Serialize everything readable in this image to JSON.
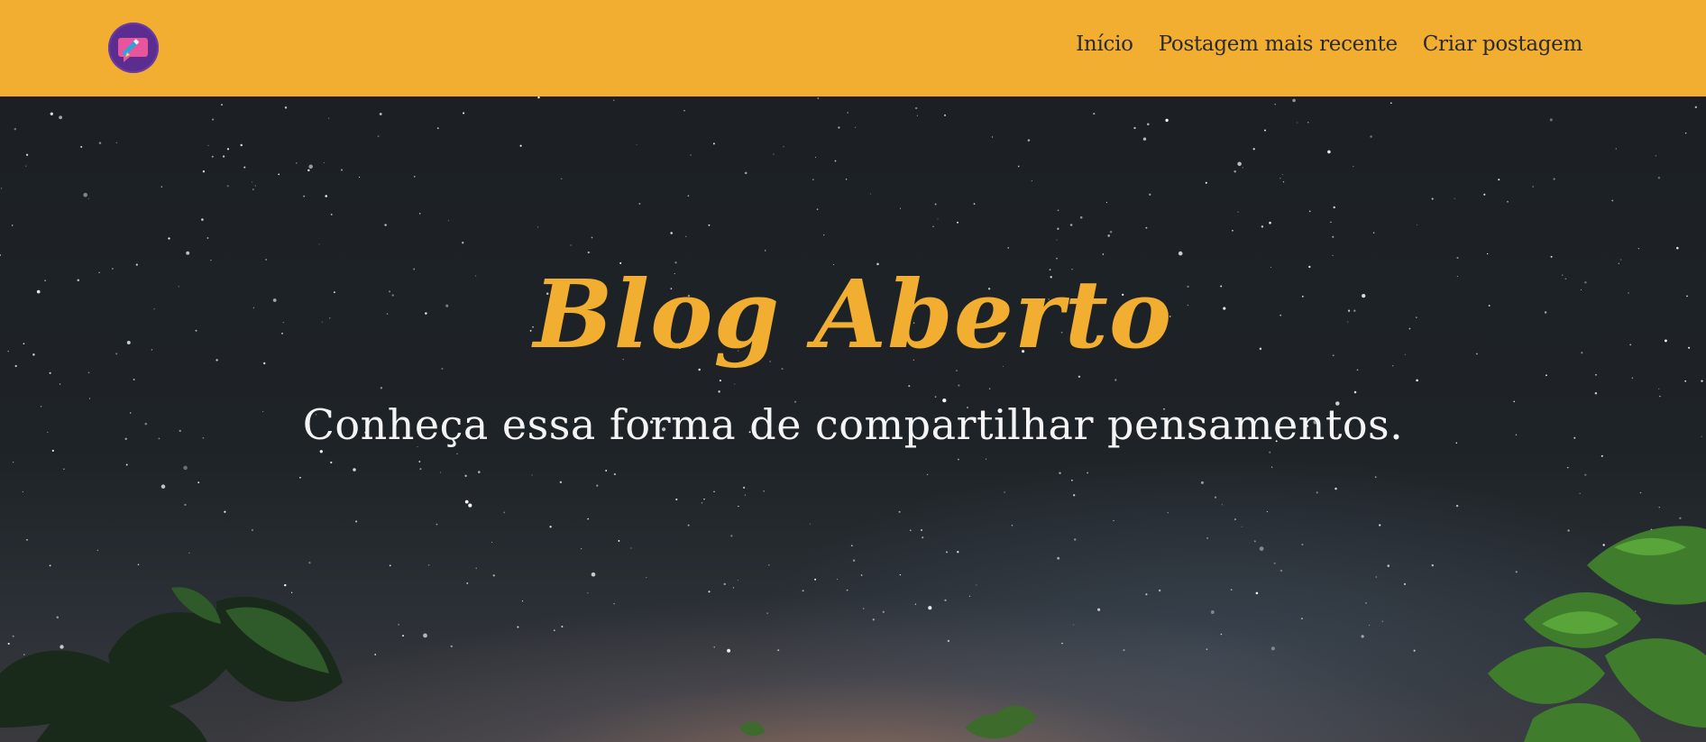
{
  "header": {
    "logo_icon": "chat-bubble-pencil-icon",
    "brand_color": "#f2ae31",
    "nav": [
      {
        "label": "Início"
      },
      {
        "label": "Postagem mais recente"
      },
      {
        "label": "Criar postagem"
      }
    ]
  },
  "hero": {
    "title": "Blog Aberto",
    "subtitle": "Conheça essa forma de compartilhar pensamentos.",
    "title_color": "#f2ae31",
    "background": "night-sky-with-stars-and-leaves"
  }
}
